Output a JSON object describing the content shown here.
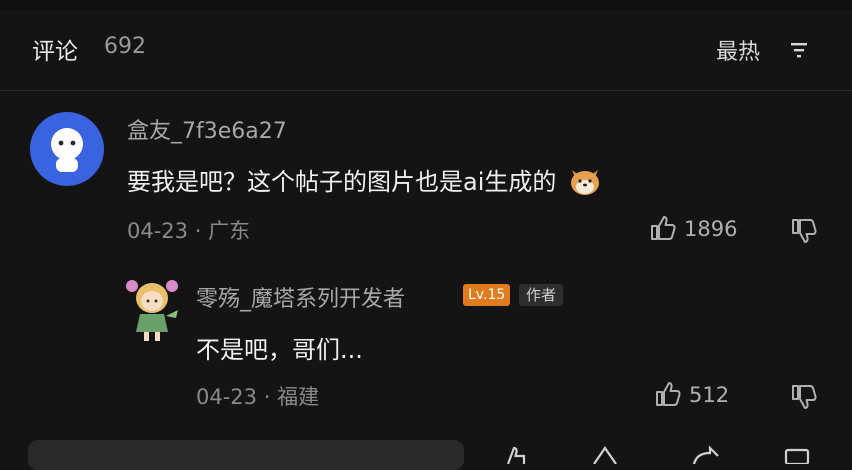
{
  "header": {
    "title": "评论",
    "count": "692",
    "sort_label": "最热"
  },
  "comments": [
    {
      "username": "盒友_7f3e6a27",
      "text": "要我是吧？这个帖子的图片也是ai生成的",
      "emoji": "dog-face-emoji",
      "date": "04-23",
      "location": "广东",
      "likes": "1896"
    },
    {
      "username": "零殇_魔塔系列开发者",
      "level_badge": "Lv.15",
      "author_badge": "作者",
      "text": "不是吧，哥们...",
      "date": "04-23",
      "location": "福建",
      "likes": "512"
    }
  ],
  "colors": {
    "background": "#141414",
    "level_badge": "#e27a1e",
    "avatar_blue": "#3a63e0"
  }
}
